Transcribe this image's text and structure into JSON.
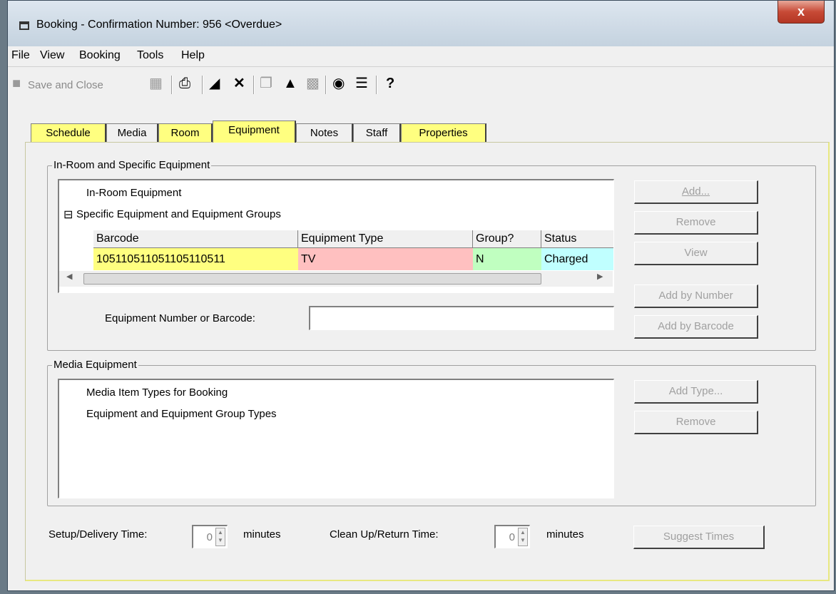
{
  "window": {
    "title": "Booking - Confirmation Number: 956  <Overdue>",
    "close_label": "x"
  },
  "menu": [
    "File",
    "View",
    "Booking",
    "Tools",
    "Help"
  ],
  "toolbar": {
    "save_close_label": "Save and Close"
  },
  "tabs": [
    "Schedule",
    "Media",
    "Room",
    "Equipment",
    "Notes",
    "Staff",
    "Properties"
  ],
  "in_room_group": {
    "title": "In-Room and Specific Equipment",
    "tree_root_1": "In-Room Equipment",
    "tree_root_2": "Specific Equipment and Equipment Groups",
    "expander": "⊟",
    "columns": [
      "Barcode",
      "Equipment Type",
      "Group?",
      "Status"
    ],
    "row": {
      "barcode": "105110511051105110511",
      "type": "TV",
      "group": "N",
      "status": "Charged"
    },
    "row_colors": {
      "barcode": "#ffff80",
      "type": "#ffc0c0",
      "group": "#c0ffc0",
      "status": "#c0ffff"
    },
    "equipment_number_label": "Equipment Number or Barcode:",
    "equipment_number_value": "",
    "buttons": {
      "add": "Add...",
      "remove": "Remove",
      "view": "View",
      "add_by_number": "Add by Number",
      "add_by_barcode": "Add by Barcode"
    }
  },
  "media_group": {
    "title": "Media Equipment",
    "item1": "Media Item Types for Booking",
    "item2": "Equipment and Equipment Group Types",
    "buttons": {
      "add_type": "Add Type...",
      "remove": "Remove"
    }
  },
  "footer": {
    "setup_label": "Setup/Delivery Time:",
    "setup_value": "0",
    "minutes_1": "minutes",
    "cleanup_label": "Clean Up/Return Time:",
    "cleanup_value": "0",
    "minutes_2": "minutes",
    "suggest_times": "Suggest Times"
  },
  "colors": {
    "tab_yellow": "#ffff80",
    "close_red": "#c74a36"
  },
  "icons": [
    "window-icon",
    "save-icon",
    "save-disk-icon",
    "print-icon",
    "move-icon",
    "delete-icon",
    "copy-icon",
    "briefcase-icon",
    "clipboard-icon",
    "binoculars-icon",
    "list-icon",
    "help-icon"
  ]
}
